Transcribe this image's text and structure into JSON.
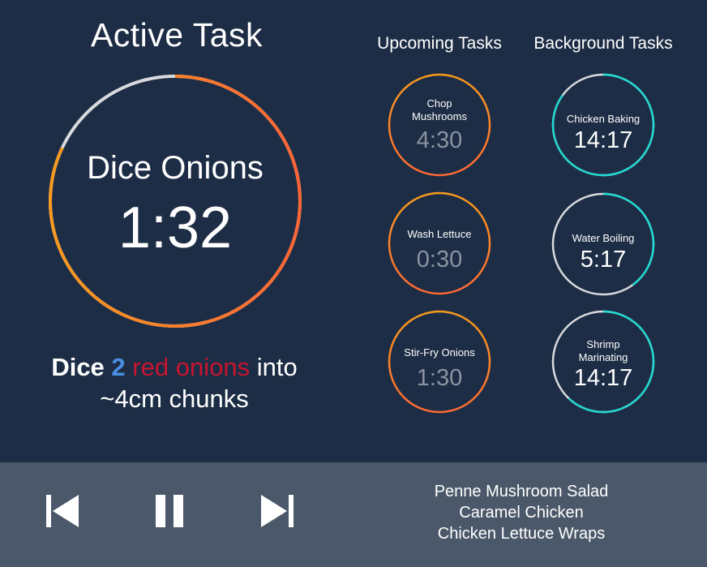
{
  "active": {
    "title": "Active Task",
    "task_name": "Dice Onions",
    "time": "1:32",
    "progress": 0.82,
    "instruction": {
      "verb": "Dice",
      "quantity": "2",
      "ingredient": "red onions",
      "rest1": "into",
      "rest2": "~4cm chunks"
    }
  },
  "upcoming": {
    "heading": "Upcoming Tasks",
    "items": [
      {
        "name_line1": "Chop",
        "name_line2": "Mushrooms",
        "time": "4:30"
      },
      {
        "name_line1": "Wash Lettuce",
        "name_line2": "",
        "time": "0:30"
      },
      {
        "name_line1": "Stir-Fry Onions",
        "name_line2": "",
        "time": "1:30"
      }
    ]
  },
  "background": {
    "heading": "Background Tasks",
    "items": [
      {
        "name_line1": "Chicken Baking",
        "name_line2": "",
        "time": "14:17",
        "progress": 0.85
      },
      {
        "name_line1": "Water Boiling",
        "name_line2": "",
        "time": "5:17",
        "progress": 0.4
      },
      {
        "name_line1": "Shrimp",
        "name_line2": "Marinating",
        "time": "14:17",
        "progress": 0.62
      }
    ]
  },
  "controls": {
    "prev_icon": "skip-previous-icon",
    "pause_icon": "pause-icon",
    "next_icon": "skip-next-icon"
  },
  "recipes": [
    "Penne Mushroom Salad",
    "Caramel Chicken",
    "Chicken Lettuce Wraps"
  ],
  "colors": {
    "background": "#1d2d45",
    "control_bar": "#4a5869",
    "orange_start": "#f79a1e",
    "orange_end": "#ff6a33",
    "cyan": "#1fd8d0",
    "grey_track": "#d9dadd",
    "quantity_blue": "#4a90e2",
    "ingredient_red": "#c8142f"
  }
}
